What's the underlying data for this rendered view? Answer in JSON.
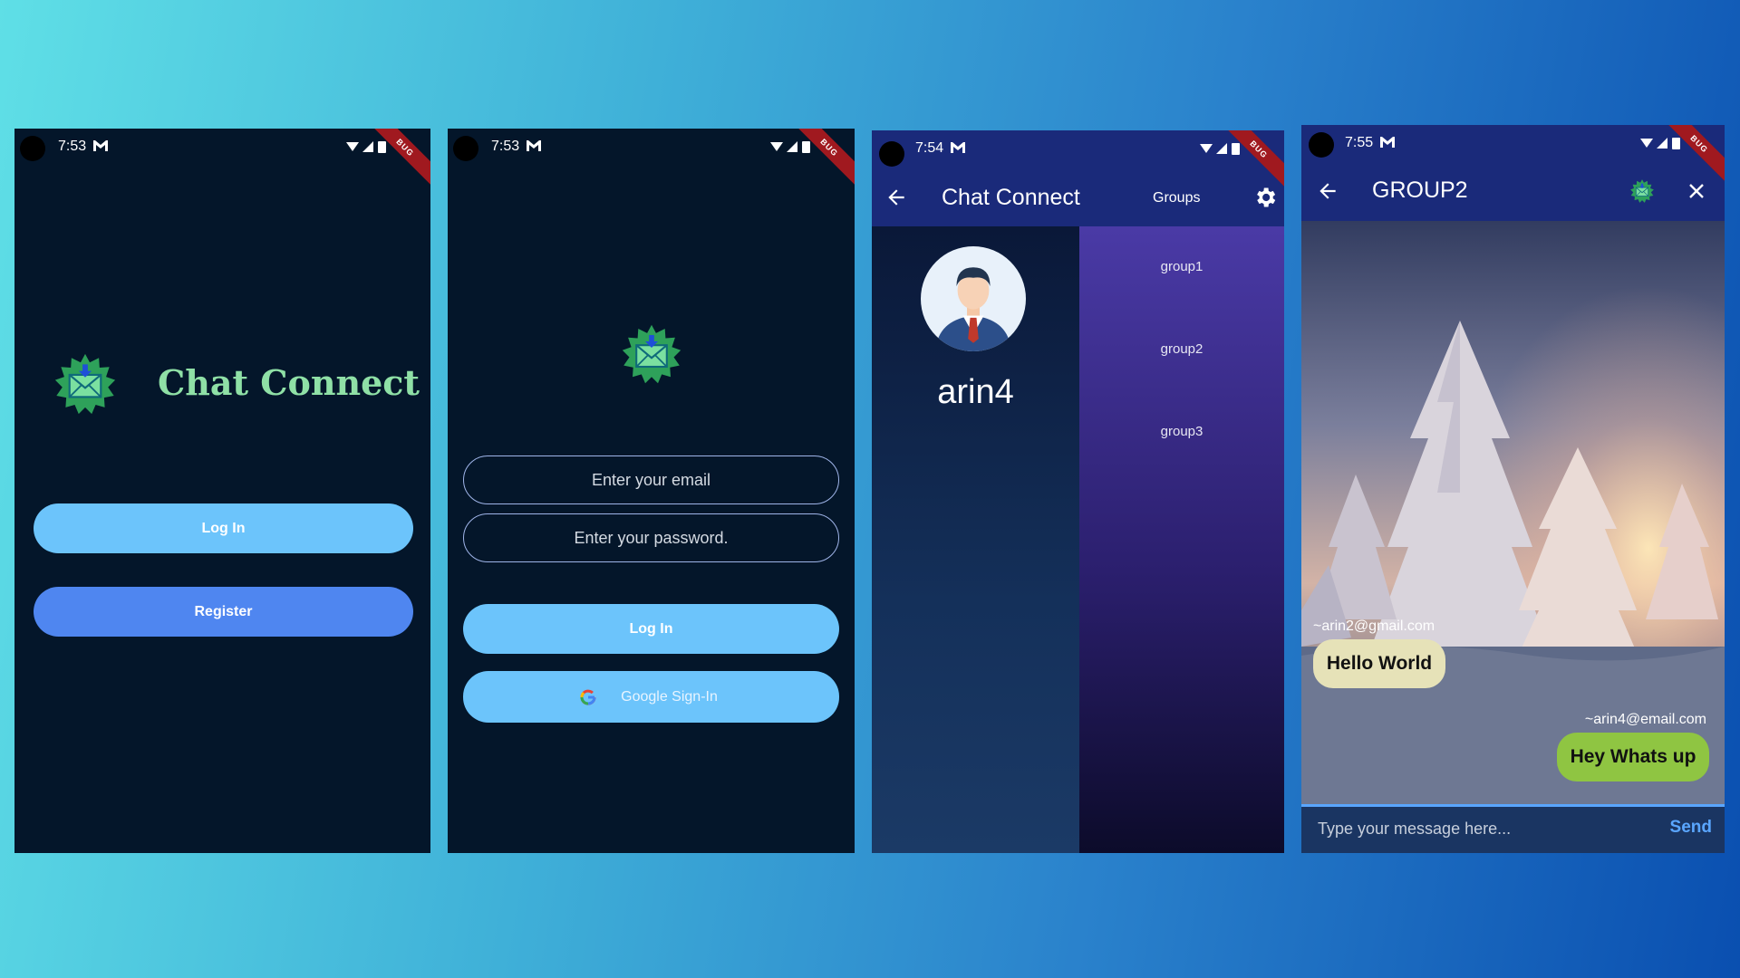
{
  "status": {
    "s1_time": "7:53",
    "s2_time": "7:53",
    "s3_time": "7:54",
    "s4_time": "7:55",
    "debug_label": "BUG"
  },
  "welcome": {
    "title": "Chat Connect",
    "login_label": "Log In",
    "register_label": "Register"
  },
  "login": {
    "email_placeholder": "Enter your email",
    "password_placeholder": "Enter your password.",
    "login_label": "Log In",
    "google_label": "Google Sign-In"
  },
  "groups": {
    "title": "Chat Connect",
    "groups_label": "Groups",
    "username": "arin4",
    "items": [
      "group1",
      "group2",
      "group3"
    ]
  },
  "chat": {
    "title": "GROUP2",
    "messages": [
      {
        "sender": "~arin2@gmail.com",
        "text": "Hello World"
      },
      {
        "sender": "~arin4@email.com",
        "text": "Hey Whats up"
      }
    ],
    "input_placeholder": "Type your message here...",
    "send_label": "Send"
  },
  "colors": {
    "accent_light_blue": "#6cc4fb",
    "accent_blue": "#4f86f0",
    "brand_green": "#8fe0a6",
    "bubble_cream": "#e6e2b8",
    "bubble_green": "#8fc542",
    "send_blue": "#5aa6ff"
  }
}
